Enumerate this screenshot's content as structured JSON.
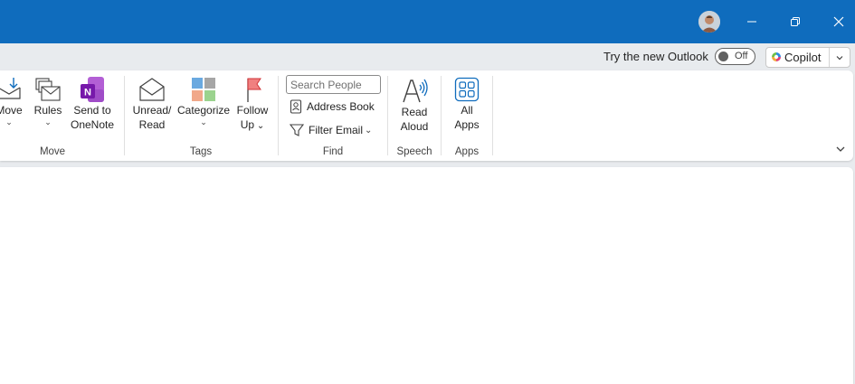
{
  "titlebar": {
    "accent_color": "#0f6cbd",
    "controls": [
      {
        "name": "minimize-icon"
      },
      {
        "name": "restore-icon"
      },
      {
        "name": "close-icon"
      }
    ]
  },
  "strip": {
    "try_label": "Try the new Outlook",
    "toggle_state": "Off",
    "copilot_label": "Copilot"
  },
  "ribbon": {
    "move_group": {
      "move_label": "Move",
      "rules_label": "Rules",
      "onenote_line1": "Send to",
      "onenote_line2": "OneNote",
      "group_label": "Move"
    },
    "tags_group": {
      "unread_line1": "Unread/",
      "unread_line2": "Read",
      "categorize_label": "Categorize",
      "followup_line1": "Follow",
      "followup_line2": "Up",
      "group_label": "Tags"
    },
    "find_group": {
      "search_placeholder": "Search People",
      "address_book_label": "Address Book",
      "filter_email_label": "Filter Email",
      "group_label": "Find"
    },
    "speech_group": {
      "read_line1": "Read",
      "read_line2": "Aloud",
      "group_label": "Speech"
    },
    "apps_group": {
      "all_line1": "All",
      "all_line2": "Apps",
      "group_label": "Apps"
    }
  }
}
